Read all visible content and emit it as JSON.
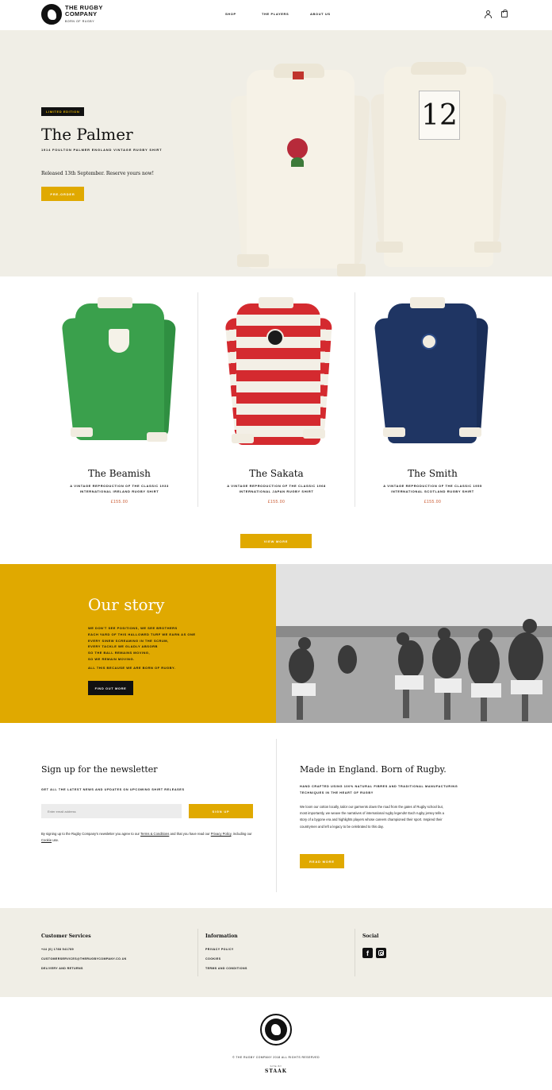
{
  "header": {
    "logo_line1": "THE RUGBY",
    "logo_line2": "COMPANY",
    "logo_line3": "BORN OF RUGBY",
    "nav": [
      "SHOP",
      "THE PLAYERS",
      "ABOUT US"
    ],
    "icons": [
      "user-icon",
      "cart-icon"
    ]
  },
  "hero": {
    "badge": "LIMITED EDITION",
    "title": "The Palmer",
    "subtitle": "1914 FOULTON PALMER ENGLAND VINTAGE RUGBY SHIRT",
    "release": "Released 13th September. Reserve yours now!",
    "button": "PRE-ORDER",
    "back_number": "12"
  },
  "products": [
    {
      "name": "The Beamish",
      "desc": "A VINTAGE REPRODUCTION OF THE CLASSIC 1933 INTERNATIONAL IRELAND RUGBY SHIRT",
      "price": "£155.00"
    },
    {
      "name": "The Sakata",
      "desc": "A VINTAGE REPRODUCTION OF THE CLASSIC 1968 INTERNATIONAL JAPAN RUGBY SHIRT",
      "price": "£155.00"
    },
    {
      "name": "The Smith",
      "desc": "A VINTAGE REPRODUCTION OF THE CLASSIC 1955 INTERNATIONAL SCOTLAND RUGBY SHIRT",
      "price": "£155.00"
    }
  ],
  "view_more": "VIEW MORE",
  "story": {
    "title": "Our story",
    "lines": [
      "WE DON'T SEE POSITIONS, WE SEE BROTHERS",
      "EACH YARD OF THIS HALLOWED TURF WE EARN AS ONE",
      "EVERY SINEW SCREAMING IN THE SCRUM,",
      "EVERY TACKLE WE GLADLY ABSORB",
      "SO THE BALL REMAINS MOVING,",
      "SO WE REMAIN MOVING."
    ],
    "closing": "ALL THIS BECAUSE WE ARE BORN OF RUGBY.",
    "button": "FIND OUT MORE"
  },
  "newsletter": {
    "title": "Sign up for the newsletter",
    "subtitle": "GET ALL THE LATEST NEWS AND UPDATES ON UPCOMING SHIRT RELEASES",
    "placeholder": "Enter email address",
    "button": "SIGN UP",
    "legal_1": "By signing up to the Rugby Company's newsletter you agree to our ",
    "legal_terms": "Terms & Conditions",
    "legal_2": " and that you have read our ",
    "legal_privacy": "Privacy Policy",
    "legal_3": ", including our ",
    "legal_cookie": "Cookie",
    "legal_4": " use."
  },
  "made": {
    "title": "Made in England. Born of Rugby.",
    "subtitle": "HAND CRAFTED USING 100% NATURAL FIBRES AND TRADITIONAL MANUFACTURING TECHNIQUES IN THE HEART OF RUGBY",
    "body": "We loom our cotton locally, tailor our garments down the road from the gates of Rugby school but, most importantly, we weave the narratives of international rugby legends! Each rugby jersey tells a story of a bygone era and highlights players whose careers championed their sport. Inspired their countrymen and left a legacy to be celebrated to this day.",
    "button": "READ MORE"
  },
  "footer": {
    "col1_title": "Customer Services",
    "col1_items": [
      "+44 (0) 1788 541789",
      "CUSTOMERSERVICES@THERUGBYCOMPANY.CO.UK",
      "DELIVERY AND RETURNS"
    ],
    "col2_title": "Information",
    "col2_items": [
      "PRIVACY POLICY",
      "COOKIES",
      "TERMS AND CONDITIONS"
    ],
    "col3_title": "Social",
    "social_icons": [
      "facebook-icon",
      "instagram-icon"
    ],
    "facebook_glyph": "f"
  },
  "bottom": {
    "copyright": "© THE RUGBY COMPANY 2018 ALL RIGHTS RESERVED",
    "site_by": "SITE BY",
    "agency": "STAAK"
  },
  "colors": {
    "accent": "#e0a900",
    "hero_bg": "#f0eee6",
    "price": "#c8542a",
    "ireland_green": "#3aa04c",
    "japan_red": "#d42a2f",
    "scotland_navy": "#1f3563"
  }
}
